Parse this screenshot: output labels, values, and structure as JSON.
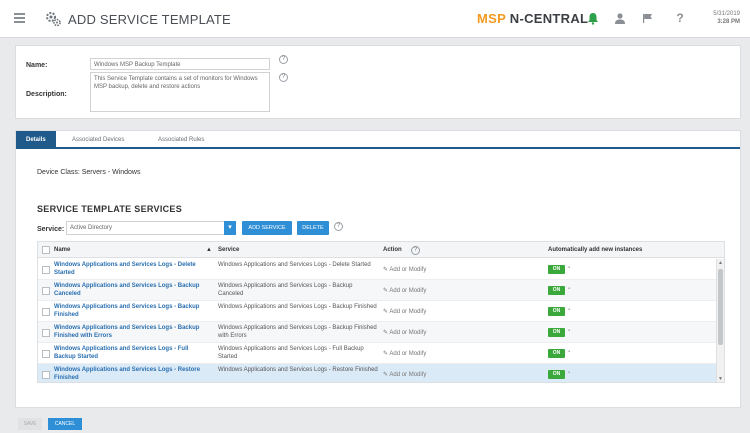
{
  "header": {
    "title": "ADD SERVICE TEMPLATE",
    "brand_msp": "MSP",
    "brand_name": "N-CENTRAL",
    "date": "5/31/2019",
    "time": "3:28 PM",
    "icons": [
      "menu-icon",
      "gears-icon",
      "bell-icon",
      "user-icon",
      "flag-icon",
      "help-icon"
    ],
    "accent": "#f39a1e",
    "bell_color": "#2e9f4a"
  },
  "form": {
    "name_label": "Name:",
    "name_value": "Windows MSP Backup Template",
    "description_label": "Description:",
    "description_value": "This Service Template contains a set of monitors for Windows MSP backup, delete and restore actions"
  },
  "tabs": [
    {
      "label": "Details",
      "active": true
    },
    {
      "label": "Associated Devices",
      "active": false
    },
    {
      "label": "Associated Rules",
      "active": false
    }
  ],
  "details": {
    "device_class": "Device Class: Servers - Windows",
    "section_title": "SERVICE TEMPLATE SERVICES",
    "service_label": "Service:",
    "service_value": "Active Directory",
    "add_service_label": "ADD SERVICE",
    "delete_label": "DELETE"
  },
  "table": {
    "columns": {
      "name": "Name",
      "service": "Service",
      "action": "Action",
      "auto": "Automatically add new instances"
    },
    "rows": [
      {
        "name": "Windows Applications and Services Logs - Delete Started",
        "service": "Windows Applications and Services Logs - Delete Started",
        "action": "Add or Modify",
        "toggle": "ON"
      },
      {
        "name": "Windows Applications and Services Logs - Backup Canceled",
        "service": "Windows Applications and Services Logs - Backup Canceled",
        "action": "Add or Modify",
        "toggle": "ON"
      },
      {
        "name": "Windows Applications and Services Logs - Backup Finished",
        "service": "Windows Applications and Services Logs - Backup Finished",
        "action": "Add or Modify",
        "toggle": "ON"
      },
      {
        "name": "Windows Applications and Services Logs - Backup Finished with Errors",
        "service": "Windows Applications and Services Logs - Backup Finished with Errors",
        "action": "Add or Modify",
        "toggle": "ON"
      },
      {
        "name": "Windows Applications and Services Logs - Full Backup Started",
        "service": "Windows Applications and Services Logs - Full Backup Started",
        "action": "Add or Modify",
        "toggle": "ON"
      },
      {
        "name": "Windows Applications and Services Logs - Restore Finished",
        "service": "Windows Applications and Services Logs - Restore Finished",
        "action": "Add or Modify",
        "toggle": "ON"
      }
    ]
  },
  "footer": {
    "save_label": "SAVE",
    "cancel_label": "CANCEL"
  }
}
